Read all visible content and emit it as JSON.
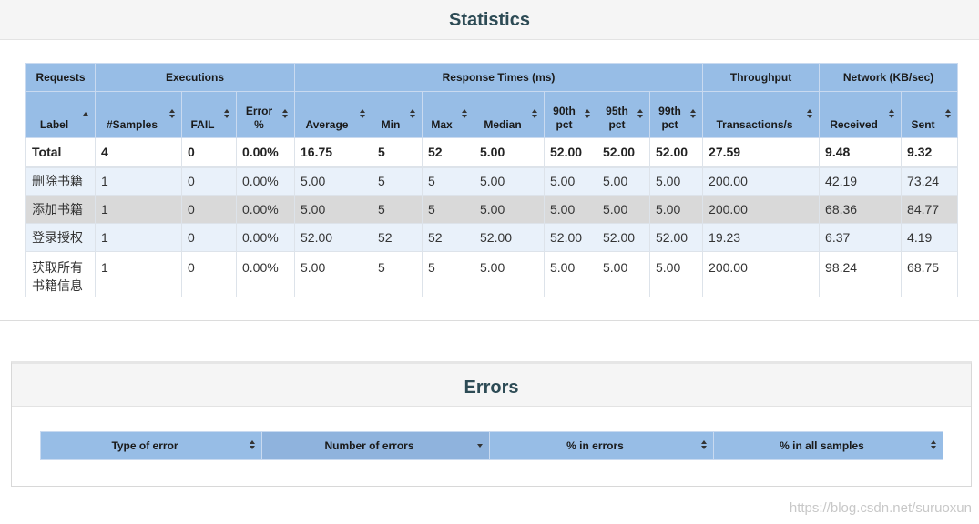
{
  "statistics": {
    "title": "Statistics",
    "groups": [
      "Requests",
      "Executions",
      "Response Times (ms)",
      "Throughput",
      "Network (KB/sec)"
    ],
    "columns": [
      {
        "label": "Label"
      },
      {
        "label": "#Samples"
      },
      {
        "label": "FAIL"
      },
      {
        "label": "Error %"
      },
      {
        "label": "Average"
      },
      {
        "label": "Min"
      },
      {
        "label": "Max"
      },
      {
        "label": "Median"
      },
      {
        "label": "90th pct"
      },
      {
        "label": "95th pct"
      },
      {
        "label": "99th pct"
      },
      {
        "label": "Transactions/s"
      },
      {
        "label": "Received"
      },
      {
        "label": "Sent"
      }
    ],
    "total": [
      "Total",
      "4",
      "0",
      "0.00%",
      "16.75",
      "5",
      "52",
      "5.00",
      "52.00",
      "52.00",
      "52.00",
      "27.59",
      "9.48",
      "9.32"
    ],
    "rows": [
      [
        "删除书籍",
        "1",
        "0",
        "0.00%",
        "5.00",
        "5",
        "5",
        "5.00",
        "5.00",
        "5.00",
        "5.00",
        "200.00",
        "42.19",
        "73.24"
      ],
      [
        "添加书籍",
        "1",
        "0",
        "0.00%",
        "5.00",
        "5",
        "5",
        "5.00",
        "5.00",
        "5.00",
        "5.00",
        "200.00",
        "68.36",
        "84.77"
      ],
      [
        "登录授权",
        "1",
        "0",
        "0.00%",
        "52.00",
        "52",
        "52",
        "52.00",
        "52.00",
        "52.00",
        "52.00",
        "19.23",
        "6.37",
        "4.19"
      ],
      [
        "获取所有书籍信息",
        "1",
        "0",
        "0.00%",
        "5.00",
        "5",
        "5",
        "5.00",
        "5.00",
        "5.00",
        "5.00",
        "200.00",
        "98.24",
        "68.75"
      ]
    ]
  },
  "errors": {
    "title": "Errors",
    "columns": [
      "Type of error",
      "Number of errors",
      "% in errors",
      "% in all samples"
    ]
  },
  "watermark": "https://blog.csdn.net/suruoxun",
  "colors": {
    "header_bg": "#97bde6",
    "odd_row_bg": "#e9f1fa",
    "hover_row_bg": "#d9d9d9",
    "title_text": "#2d4b55"
  }
}
